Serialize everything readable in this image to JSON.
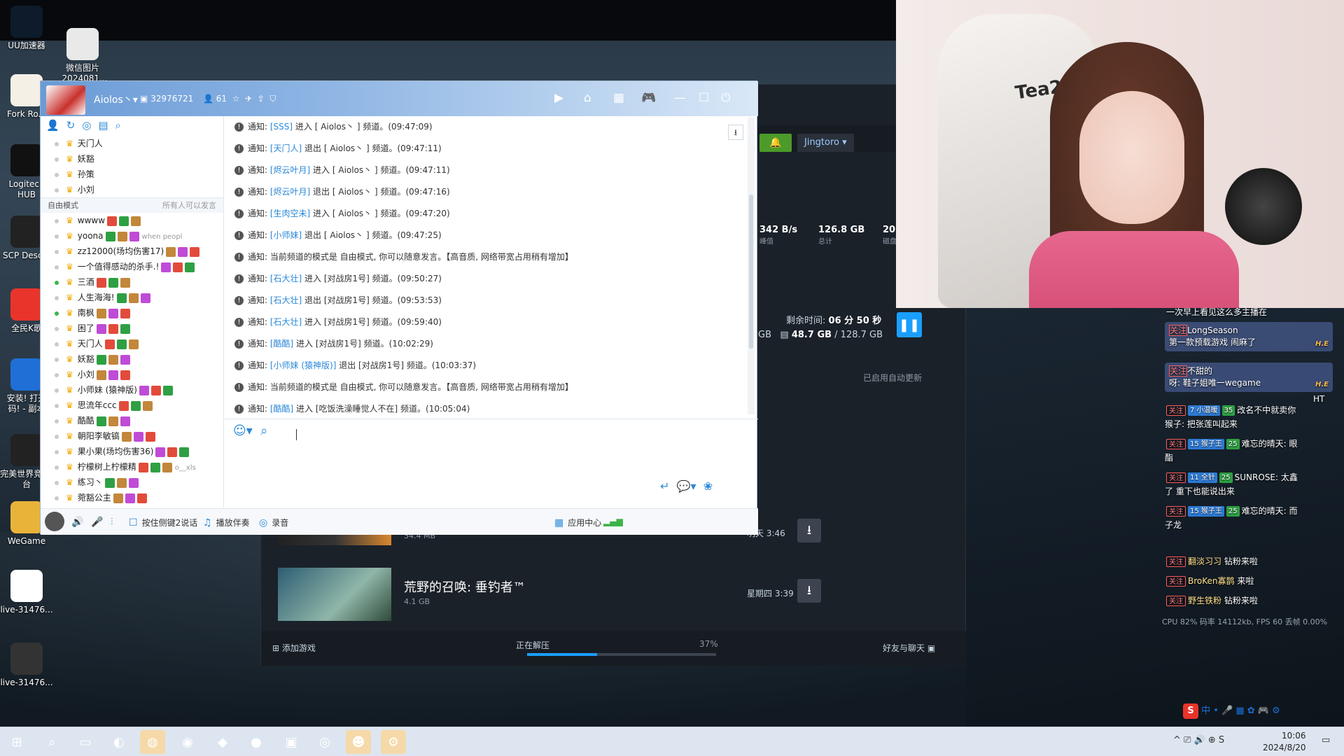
{
  "desktop": {
    "icons": [
      {
        "label": "UU加速器",
        "icon": "uu-icon"
      },
      {
        "label": "微信图片_2024081...",
        "icon": "image-icon"
      },
      {
        "label": "Fork Ro...",
        "icon": "fork-road-icon"
      },
      {
        "label": "Logitech HUB",
        "icon": "logitech-icon"
      },
      {
        "label": "SCP Desc...",
        "icon": "scp-icon"
      },
      {
        "label": "全民K歌",
        "icon": "karaoke-icon"
      },
      {
        "label": "安装! 打开 码! - 副本",
        "icon": "installer-icon"
      },
      {
        "label": "完美世界竞 平台",
        "icon": "perfect-world-icon"
      },
      {
        "label": "WeGame",
        "icon": "wegame-icon"
      },
      {
        "label": "live-31476...",
        "icon": "file-icon"
      },
      {
        "label": "live-31476...",
        "icon": "video-file-icon"
      }
    ]
  },
  "steam": {
    "user": "Jingtoro",
    "stats": [
      {
        "value": "342 B/s",
        "label": "峰值"
      },
      {
        "value": "126.8 GB",
        "label": "总计"
      },
      {
        "value": "20",
        "label": "磁盘"
      }
    ],
    "remaining_label": "剩余时间:",
    "remaining_value": "06 分 50 秒",
    "disk_prefix": "GB",
    "disk_used": "48.7 GB",
    "disk_total": "/ 128.7 GB",
    "auto_update": "已启用自动更新",
    "games": [
      {
        "name": "",
        "size": "34.4 MB",
        "time": "明天 3:46"
      },
      {
        "name": "荒野的召唤: 垂钓者™",
        "size": "4.1 GB",
        "time": "星期四 3:39"
      }
    ],
    "add_game": "添加游戏",
    "unpacking": "正在解压",
    "unpack_progress_label": "37%",
    "unpack_progress": 0.37,
    "friends_chat": "好友与聊天"
  },
  "yy": {
    "title": "Aiolos丶",
    "channel_id": "32976721",
    "online_count": "61",
    "top_users": [
      "天门人",
      "妖豁",
      "孙策",
      "小刘"
    ],
    "mode_label": "自由模式",
    "mode_right": "所有人可以发言",
    "users": [
      {
        "name": "wwww",
        "online": false
      },
      {
        "name": "yoona",
        "online": false,
        "extra": "when peopl"
      },
      {
        "name": "zz12000(场均伤害17)",
        "online": false
      },
      {
        "name": "一个值得感动的杀手.!",
        "online": false
      },
      {
        "name": "三酒",
        "online": true
      },
      {
        "name": "人生海海!",
        "online": false
      },
      {
        "name": "南枫",
        "online": true
      },
      {
        "name": "困了",
        "online": false
      },
      {
        "name": "天门人",
        "online": false
      },
      {
        "name": "妖豁",
        "online": false
      },
      {
        "name": "小刘",
        "online": false
      },
      {
        "name": "小师妹 (猿神版)",
        "online": false
      },
      {
        "name": "思流年ccc",
        "online": false
      },
      {
        "name": "酷酷",
        "online": false
      },
      {
        "name": "朝阳李敏镐",
        "online": false
      },
      {
        "name": "果小果(场均伤害36)",
        "online": false
      },
      {
        "name": "柠檬树上柠檬精",
        "online": false,
        "extra": "o__xls"
      },
      {
        "name": "练习丶",
        "online": false
      },
      {
        "name": "菀豁公主",
        "online": false
      }
    ],
    "messages": [
      {
        "pre": "通知: ",
        "who": "[SSS]",
        "text": " 进入 [          Aiolos丶 ] 频道。(09:47:09)"
      },
      {
        "pre": "通知: ",
        "who": "[天门人]",
        "text": " 退出 [          Aiolos丶 ] 频道。(09:47:11)"
      },
      {
        "pre": "通知: ",
        "who": "[烬云叶月]",
        "text": " 进入 [          Aiolos丶 ] 频道。(09:47:11)"
      },
      {
        "pre": "通知: ",
        "who": "[烬云叶月]",
        "text": " 退出 [          Aiolos丶 ] 频道。(09:47:16)"
      },
      {
        "pre": "通知: ",
        "who": "[生肉空未]",
        "text": " 进入 [          Aiolos丶 ] 频道。(09:47:20)"
      },
      {
        "pre": "通知: ",
        "who": "[小师妹]",
        "text": " 退出 [          Aiolos丶 ] 频道。(09:47:25)"
      },
      {
        "pre": "通知: ",
        "who": "",
        "text": "当前频道的模式是 自由模式, 你可以随意发言。【高音质, 网络带宽占用稍有增加】"
      },
      {
        "pre": "通知: ",
        "who": "[石大壮]",
        "text": " 进入 [对战房1号] 频道。(09:50:27)"
      },
      {
        "pre": "通知: ",
        "who": "[石大壮]",
        "text": " 退出 [对战房1号] 频道。(09:53:53)"
      },
      {
        "pre": "通知: ",
        "who": "[石大壮]",
        "text": " 进入 [对战房1号] 频道。(09:59:40)"
      },
      {
        "pre": "通知: ",
        "who": "[酷酷]",
        "text": " 进入 [对战房1号] 频道。(10:02:29)"
      },
      {
        "pre": "通知: ",
        "who": "[小师妹 (猿神版)]",
        "text": " 退出 [对战房1号] 频道。(10:03:37)"
      },
      {
        "pre": "通知: ",
        "who": "",
        "text": "当前频道的模式是 自由模式, 你可以随意发言。【高音质, 网络带宽占用稍有增加】"
      },
      {
        "pre": "通知: ",
        "who": "[酷酷]",
        "text": " 进入 [吃饭洗澡睡觉人不在] 频道。(10:05:04)"
      }
    ],
    "bottom": {
      "push_to_talk": "按住侧键2说话",
      "accompany": "播放伴奏",
      "record": "录音",
      "app_center": "应用中心"
    }
  },
  "webcam": {
    "chair_text": "Tea2 e"
  },
  "danmu": {
    "top_text": "一次早上看见这么多主播在",
    "cards": [
      {
        "user": "LongSeason",
        "text": "第一款预载游戏 闹麻了",
        "he": "H.E"
      },
      {
        "user": "不甜的",
        "text": "呀: 鞋子姐唯一wegame",
        "he": "H.E"
      }
    ],
    "lines": [
      {
        "tag": "7",
        "tagname": "小温暖",
        "lv": "35",
        "text": "改名不中就卖你",
        "text2": "猴子: 把张莲叫起来"
      },
      {
        "tag": "15",
        "tagname": "猴子王",
        "lv": "25",
        "text": "难忘的晴天: 眼",
        "text2": "酯"
      },
      {
        "tag": "11",
        "tagname": "全针",
        "lv": "25",
        "text": "SUNROSE: 太鑫",
        "text2": "了 重下也能说出来"
      },
      {
        "tag": "15",
        "tagname": "猴子王",
        "lv": "25",
        "text": "难忘的晴天: 而",
        "text2": "子龙"
      }
    ],
    "joins": [
      {
        "name": "翻淡习习",
        "suffix": "钻粉来啦"
      },
      {
        "name": "BroKen寡鹊",
        "suffix": "来啦"
      },
      {
        "name": "野生铁粉",
        "suffix": "钻粉来啦"
      }
    ],
    "follow_tag": "关注",
    "ht": "HT",
    "stats": "CPU 82% 码率 14112kb, FPS 60 丢帧 0.00%"
  },
  "taskbar": {
    "time": "10:06",
    "date": "2024/8/20",
    "ime_label": "中"
  }
}
